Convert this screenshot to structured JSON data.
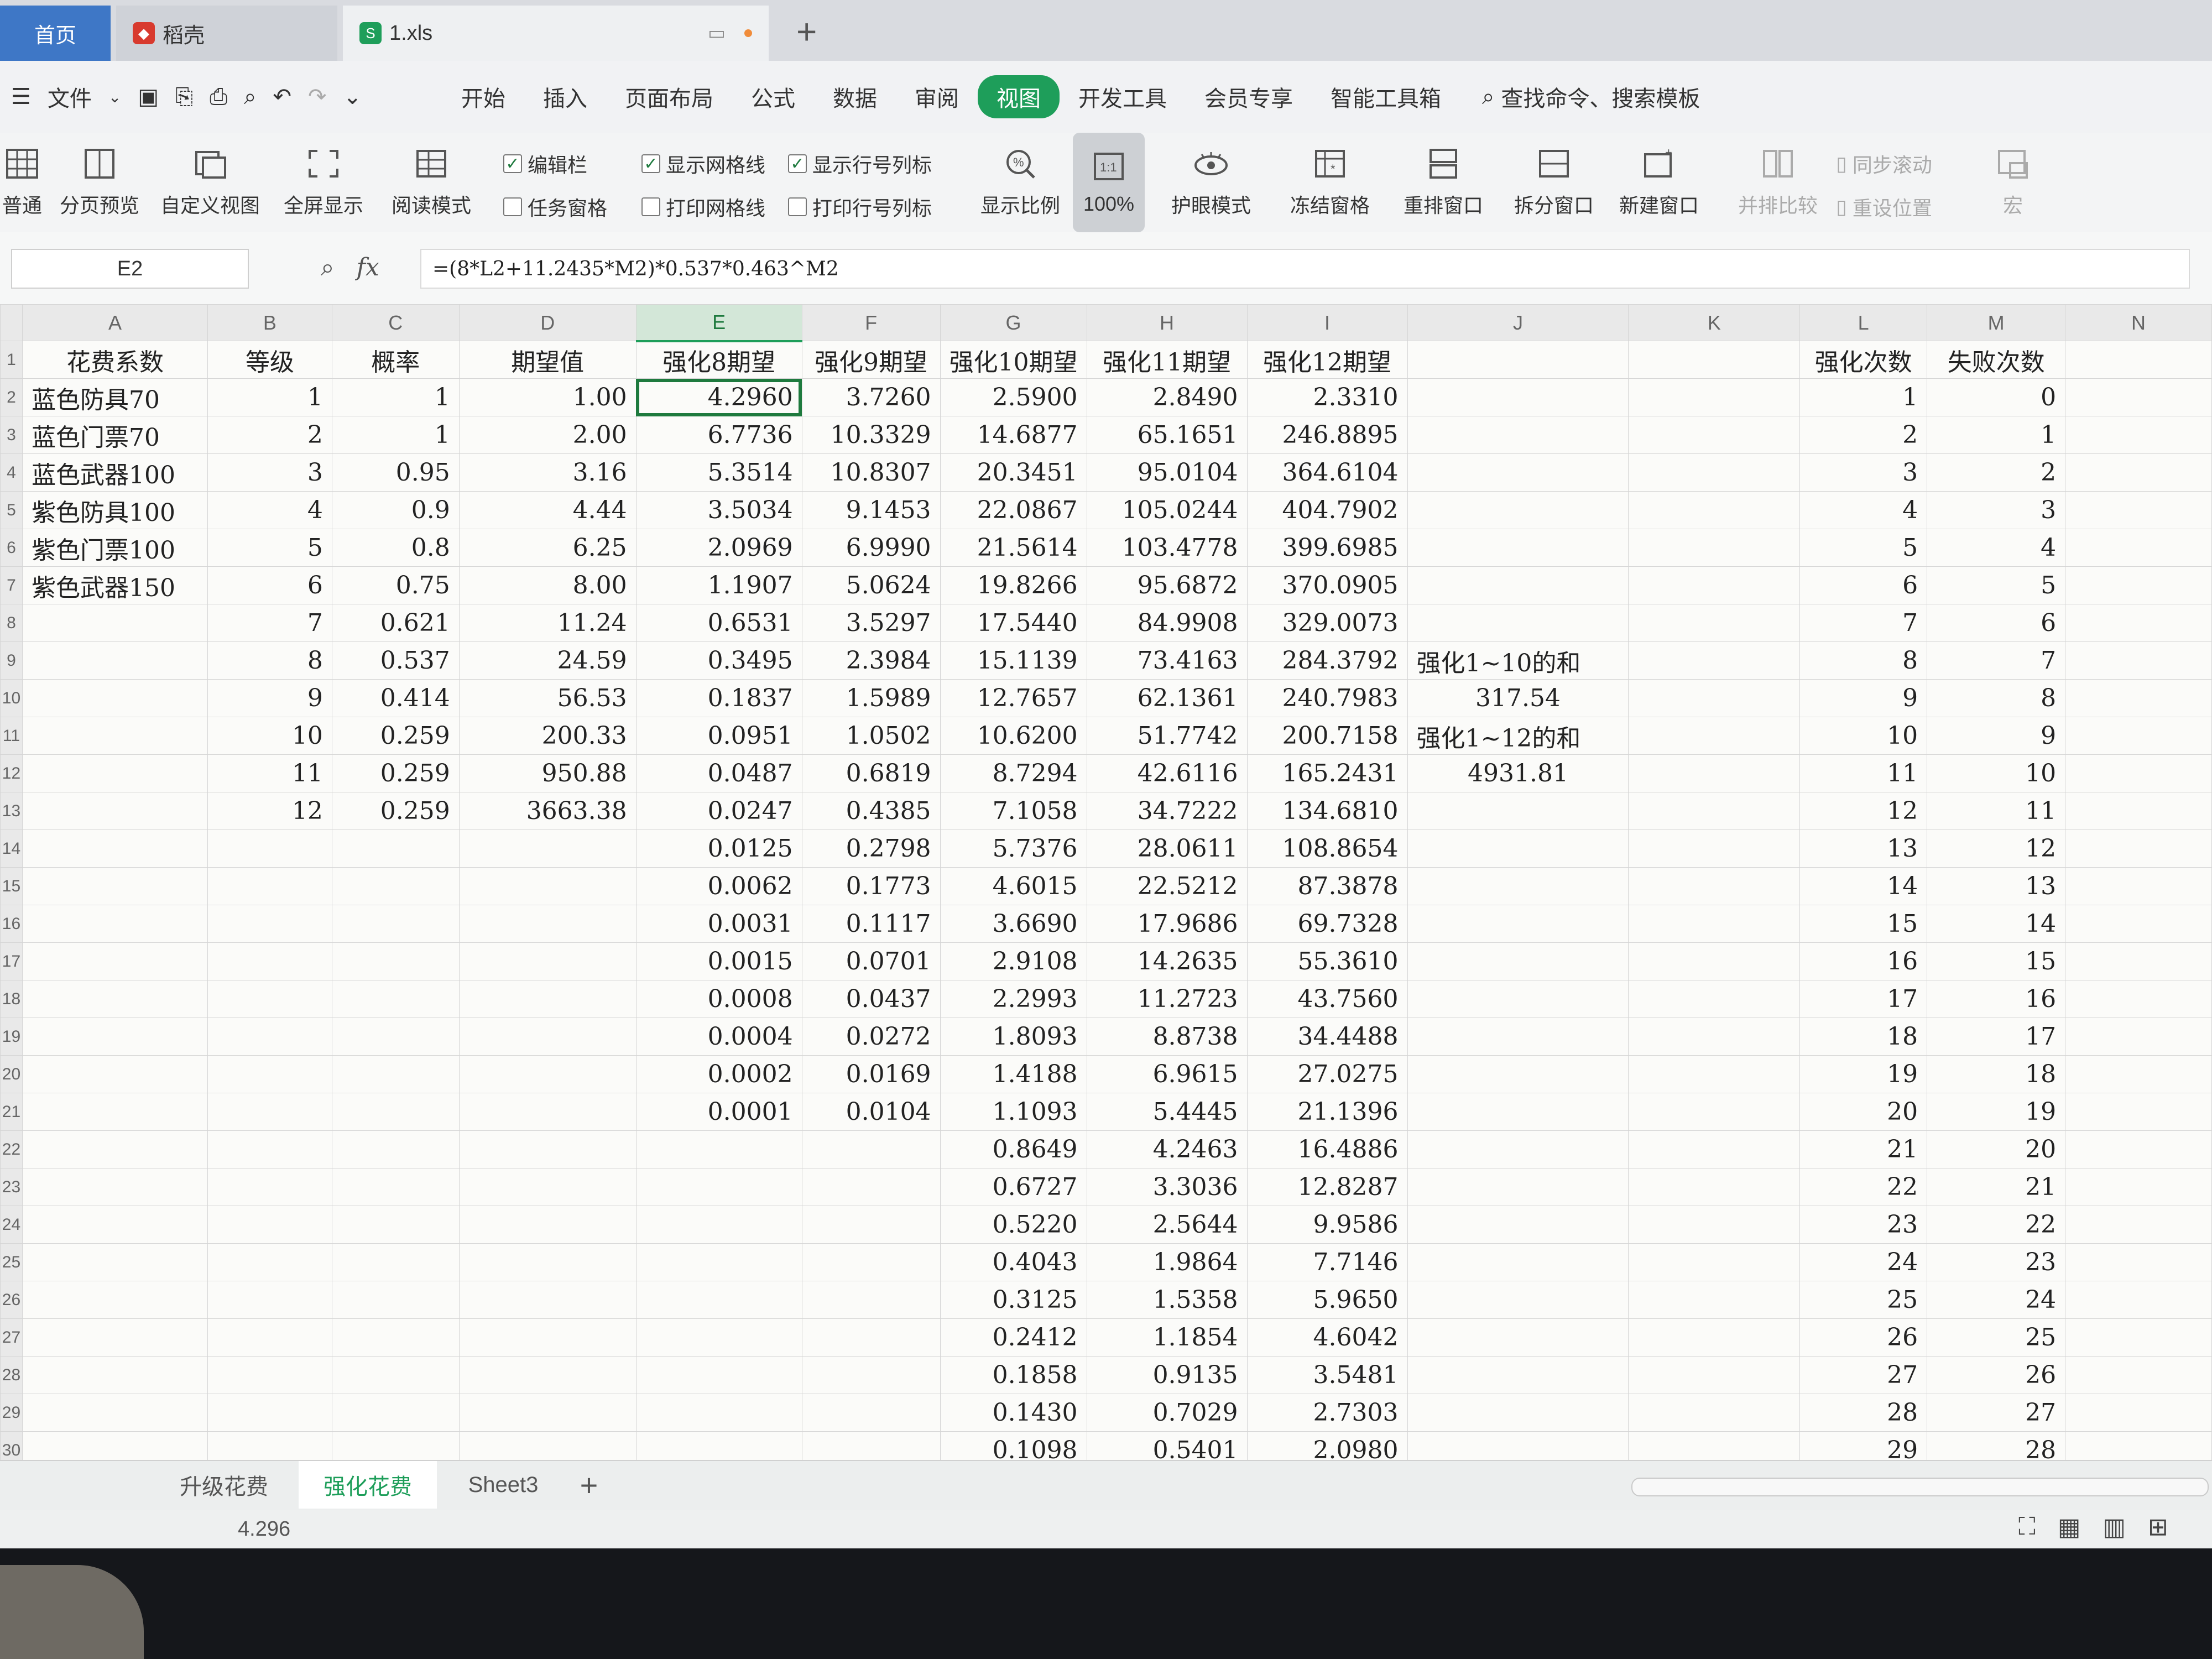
{
  "tabs": {
    "home": "首页",
    "docer": "稻壳",
    "file": "1.xls",
    "add": "+"
  },
  "menu": {
    "file": "文件",
    "items": [
      "开始",
      "插入",
      "页面布局",
      "公式",
      "数据",
      "审阅",
      "视图",
      "开发工具",
      "会员专享",
      "智能工具箱"
    ],
    "active_index": 6,
    "search": "查找命令、搜索模板"
  },
  "ribbon": {
    "normal": "普通",
    "page_break": "分页预览",
    "custom_view": "自定义视图",
    "fullscreen": "全屏显示",
    "reading_mode": "阅读模式",
    "edit_bar": "编辑栏",
    "task_pane": "任务窗格",
    "show_gridlines": "显示网格线",
    "print_gridlines": "打印网格线",
    "show_headers": "显示行号列标",
    "print_headers": "打印行号列标",
    "zoom": "显示比例",
    "zoom_100": "100%",
    "eye_mode": "护眼模式",
    "freeze": "冻结窗格",
    "arrange": "重排窗口",
    "split": "拆分窗口",
    "new_window": "新建窗口",
    "side_by_side": "并排比较",
    "sync_scroll": "同步滚动",
    "reset_position": "重设位置",
    "macro": "宏"
  },
  "formula_bar": {
    "cell_ref": "E2",
    "fx": "fx",
    "formula": "=(8*L2+11.2435*M2)*0.537*0.463^M2"
  },
  "sheet": {
    "col_headers": [
      "A",
      "B",
      "C",
      "D",
      "E",
      "F",
      "G",
      "H",
      "I",
      "J",
      "K",
      "L",
      "M",
      "N"
    ],
    "row_headers": [
      "1",
      "2",
      "3",
      "4",
      "5",
      "6",
      "7",
      "8",
      "9",
      "10",
      "11",
      "12",
      "13",
      "14",
      "15",
      "16",
      "17",
      "18",
      "19",
      "20",
      "21",
      "22",
      "23",
      "24",
      "25",
      "26",
      "27",
      "28",
      "29",
      "30"
    ],
    "header_row": {
      "A": "花费系数",
      "B": "等级",
      "C": "概率",
      "D": "期望值",
      "E": "强化8期望",
      "F": "强化9期望",
      "G": "强化10期望",
      "H": "强化11期望",
      "I": "强化12期望",
      "L": "强化次数",
      "M": "失败次数"
    },
    "col_A": [
      "蓝色防具70",
      "蓝色门票70",
      "蓝色武器100",
      "紫色防具100",
      "紫色门票100",
      "紫色武器150"
    ],
    "col_B": [
      "1",
      "2",
      "3",
      "4",
      "5",
      "6",
      "7",
      "8",
      "9",
      "10",
      "11",
      "12"
    ],
    "col_C": [
      "1",
      "1",
      "0.95",
      "0.9",
      "0.8",
      "0.75",
      "0.621",
      "0.537",
      "0.414",
      "0.259",
      "0.259",
      "0.259"
    ],
    "col_D": [
      "1.00",
      "2.00",
      "3.16",
      "4.44",
      "6.25",
      "8.00",
      "11.24",
      "24.59",
      "56.53",
      "200.33",
      "950.88",
      "3663.38"
    ],
    "col_E": [
      "4.2960",
      "6.7736",
      "5.3514",
      "3.5034",
      "2.0969",
      "1.1907",
      "0.6531",
      "0.3495",
      "0.1837",
      "0.0951",
      "0.0487",
      "0.0247",
      "0.0125",
      "0.0062",
      "0.0031",
      "0.0015",
      "0.0008",
      "0.0004",
      "0.0002",
      "0.0001"
    ],
    "col_F": [
      "3.7260",
      "10.3329",
      "10.8307",
      "9.1453",
      "6.9990",
      "5.0624",
      "3.5297",
      "2.3984",
      "1.5989",
      "1.0502",
      "0.6819",
      "0.4385",
      "0.2798",
      "0.1773",
      "0.1117",
      "0.0701",
      "0.0437",
      "0.0272",
      "0.0169",
      "0.0104"
    ],
    "col_G": [
      "2.5900",
      "14.6877",
      "20.3451",
      "22.0867",
      "21.5614",
      "19.8266",
      "17.5440",
      "15.1139",
      "12.7657",
      "10.6200",
      "8.7294",
      "7.1058",
      "5.7376",
      "4.6015",
      "3.6690",
      "2.9108",
      "2.2993",
      "1.8093",
      "1.4188",
      "1.1093",
      "0.8649",
      "0.6727",
      "0.5220",
      "0.4043",
      "0.3125",
      "0.2412",
      "0.1858",
      "0.1430",
      "0.1098"
    ],
    "col_H": [
      "2.8490",
      "65.1651",
      "95.0104",
      "105.0244",
      "103.4778",
      "95.6872",
      "84.9908",
      "73.4163",
      "62.1361",
      "51.7742",
      "42.6116",
      "34.7222",
      "28.0611",
      "22.5212",
      "17.9686",
      "14.2635",
      "11.2723",
      "8.8738",
      "6.9615",
      "5.4445",
      "4.2463",
      "3.3036",
      "2.5644",
      "1.9864",
      "1.5358",
      "1.1854",
      "0.9135",
      "0.7029",
      "0.5401"
    ],
    "col_I": [
      "2.3310",
      "246.8895",
      "364.6104",
      "404.7902",
      "399.6985",
      "370.0905",
      "329.0073",
      "284.3792",
      "240.7983",
      "200.7158",
      "165.2431",
      "134.6810",
      "108.8654",
      "87.3878",
      "69.7328",
      "55.3610",
      "43.7560",
      "34.4488",
      "27.0275",
      "21.1396",
      "16.4886",
      "12.8287",
      "9.9586",
      "7.7146",
      "5.9650",
      "4.6042",
      "3.5481",
      "2.7303",
      "2.0980"
    ],
    "col_J": [
      "",
      "",
      "",
      "",
      "",
      "",
      "",
      "强化1~10的和",
      "317.54",
      "强化1~12的和",
      "4931.81"
    ],
    "col_L": [
      "1",
      "2",
      "3",
      "4",
      "5",
      "6",
      "7",
      "8",
      "9",
      "10",
      "11",
      "12",
      "13",
      "14",
      "15",
      "16",
      "17",
      "18",
      "19",
      "20",
      "21",
      "22",
      "23",
      "24",
      "25",
      "26",
      "27",
      "28",
      "29"
    ],
    "col_M": [
      "0",
      "1",
      "2",
      "3",
      "4",
      "5",
      "6",
      "7",
      "8",
      "9",
      "10",
      "11",
      "12",
      "13",
      "14",
      "15",
      "16",
      "17",
      "18",
      "19",
      "20",
      "21",
      "22",
      "23",
      "24",
      "25",
      "26",
      "27",
      "28"
    ]
  },
  "sheet_tabs": [
    "升级花费",
    "强化花费",
    "Sheet3"
  ],
  "active_sheet_index": 1,
  "status": {
    "value": "4.296"
  },
  "colors": {
    "accent": "#1e9e5a",
    "home_tab": "#3e77c6"
  }
}
